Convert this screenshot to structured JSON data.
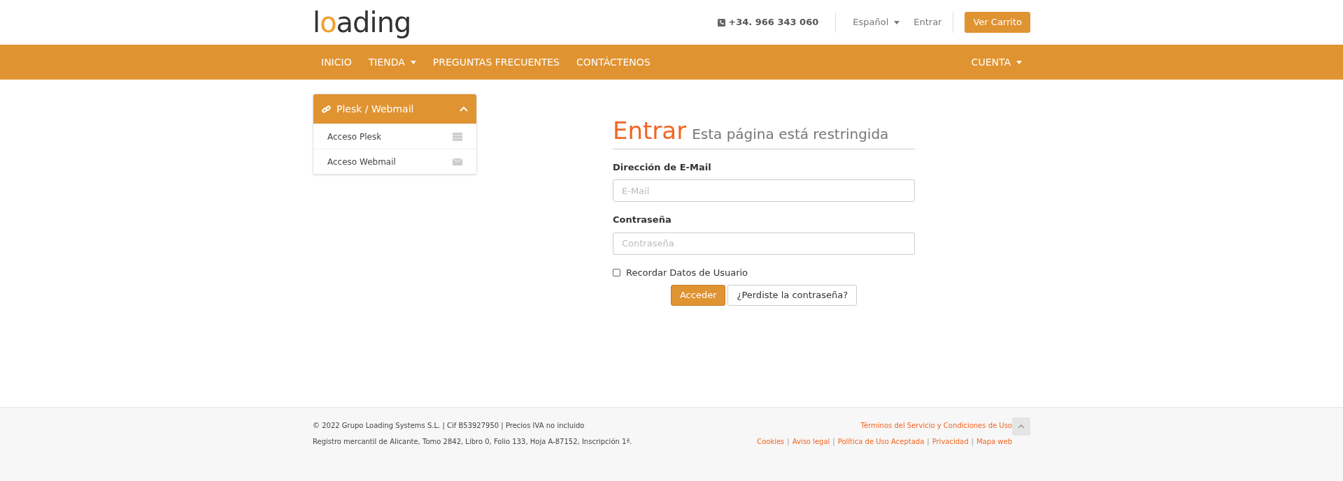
{
  "header": {
    "logo": "loading",
    "phone": "+34. 966 343 060",
    "language": "Español",
    "login_link": "Entrar",
    "cart_button": "Ver Carrito"
  },
  "nav": {
    "items": [
      {
        "label": "INICIO",
        "dropdown": false
      },
      {
        "label": "TIENDA",
        "dropdown": true
      },
      {
        "label": "PREGUNTAS FRECUENTES",
        "dropdown": false
      },
      {
        "label": "CONTÁCTENOS",
        "dropdown": false
      }
    ],
    "account": {
      "label": "CUENTA",
      "dropdown": true
    }
  },
  "sidebar": {
    "title": "Plesk / Webmail",
    "expanded": true,
    "items": [
      {
        "label": "Acceso Plesk",
        "kind": "server"
      },
      {
        "label": "Acceso Webmail",
        "kind": "mail"
      }
    ]
  },
  "login": {
    "title": "Entrar",
    "subtitle": "Esta página está restringida",
    "email_label": "Dirección de E-Mail",
    "email_placeholder": "E-Mail",
    "password_label": "Contraseña",
    "password_placeholder": "Contraseña",
    "remember": {
      "label": "Recordar Datos de Usuario",
      "checked": false
    },
    "submit": "Acceder",
    "forgot": "¿Perdiste la contraseña?"
  },
  "footer": {
    "lines": [
      "© 2022 Grupo Loading Systems S.L. | Cif B53927950 | Precios IVA no incluido",
      "Registro mercantil de Alicante, Tomo 2842, Libro 0, Folio 133, Hoja A-87152, Inscripción 1ª."
    ],
    "terms_link": "Términos del Servicio y Condiciones de Uso",
    "separator": "|",
    "links": [
      "Cookies",
      "Aviso legal",
      "Política de Uso Aceptada",
      "Privacidad",
      "Mapa web"
    ]
  }
}
